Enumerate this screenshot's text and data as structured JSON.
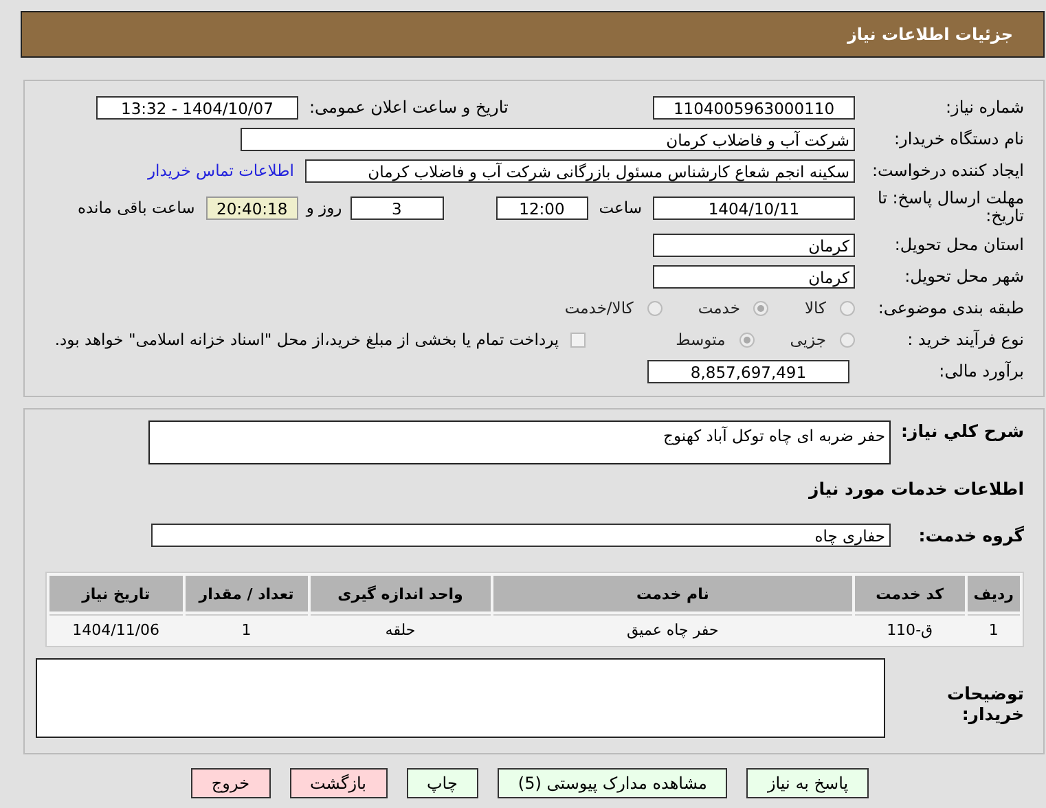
{
  "header": {
    "title": "جزئیات اطلاعات نیاز"
  },
  "need_number": {
    "label": "شماره نیاز:",
    "value": "1104005963000110"
  },
  "announce": {
    "label": "تاریخ و ساعت اعلان عمومی:",
    "value": "1404/10/07 - 13:32"
  },
  "buyer_org": {
    "label": "نام دستگاه خریدار:",
    "value": "شرکت آب و فاضلاب کرمان"
  },
  "requester": {
    "label": "ایجاد کننده درخواست:",
    "value": "سکینه انجم شعاع کارشناس مسئول بازرگانی شرکت آب و فاضلاب کرمان",
    "link": "اطلاعات تماس خریدار"
  },
  "deadline": {
    "label": "مهلت ارسال پاسخ: تا تاریخ:",
    "date": "1404/10/11",
    "time_label": "ساعت",
    "time": "12:00",
    "days": "3",
    "days_label": "روز و",
    "remaining": "20:40:18",
    "remaining_label": "ساعت باقی مانده"
  },
  "province": {
    "label": "استان محل تحویل:",
    "value": "کرمان"
  },
  "city": {
    "label": "شهر محل تحویل:",
    "value": "کرمان"
  },
  "category": {
    "label": "طبقه بندی موضوعی:",
    "options": [
      {
        "label": "کالا",
        "selected": false
      },
      {
        "label": "خدمت",
        "selected": true
      },
      {
        "label": "کالا/خدمت",
        "selected": false
      }
    ]
  },
  "purchase_type": {
    "label": "نوع فرآیند خرید :",
    "options": [
      {
        "label": "جزیی",
        "selected": false
      },
      {
        "label": "متوسط",
        "selected": true
      }
    ],
    "payment": {
      "checked": false,
      "text": "پرداخت تمام یا بخشی از مبلغ خرید،از محل \"اسناد خزانه اسلامی\" خواهد بود."
    }
  },
  "estimate": {
    "label": "برآورد مالی:",
    "value": "8,857,697,491"
  },
  "summary": {
    "label": "شرح کلي نیاز:",
    "value": "حفر ضربه ای چاه توکل آباد کهنوج"
  },
  "services_heading": "اطلاعات خدمات مورد نیاز",
  "service_group": {
    "label": "گروه خدمت:",
    "value": "حفاری چاه"
  },
  "table": {
    "columns": [
      "ردیف",
      "کد خدمت",
      "نام خدمت",
      "واحد اندازه گیری",
      "تعداد / مقدار",
      "تاریخ نیاز"
    ],
    "rows": [
      [
        "1",
        "ق-110",
        "حفر چاه عمیق",
        "حلقه",
        "1",
        "1404/11/06"
      ]
    ]
  },
  "buyer_notes": {
    "label": "توضیحات خریدار:"
  },
  "buttons": [
    {
      "label": "پاسخ به نیاز",
      "kind": "normal"
    },
    {
      "label": "مشاهده مدارک پیوستی (5)",
      "kind": "normal"
    },
    {
      "label": "چاپ",
      "kind": "normal"
    },
    {
      "label": "بازگشت",
      "kind": "exit"
    },
    {
      "label": "خروج",
      "kind": "exit"
    }
  ]
}
